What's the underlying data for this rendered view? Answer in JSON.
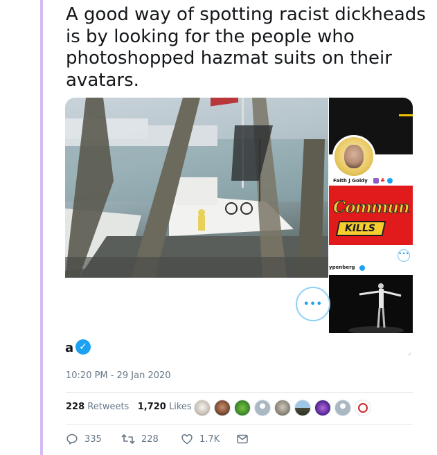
{
  "tweet": {
    "text": "A good way of spotting racist dickheads is by looking for the people who photoshopped hazmat suits on their avatars.",
    "timestamp": "10:20 PM - 29 Jan 2020",
    "retweets_count": "228",
    "retweets_label": "Retweets",
    "likes_count": "1,720",
    "likes_label": "Likes"
  },
  "media": {
    "avatar_name": "Faith J Goldy",
    "commu_text": "Commun",
    "kills_text": "KILLS",
    "penberg_name": "ypenberg",
    "partial_name": "a",
    "more_glyph": "•••",
    "small_more_glyph": "•••"
  },
  "actions": {
    "reply_count": "335",
    "retweet_count": "228",
    "like_count": "1.7K"
  },
  "likers": [
    "liker-1",
    "liker-2",
    "liker-3",
    "liker-4",
    "liker-5",
    "liker-6",
    "liker-7",
    "liker-8",
    "liker-9"
  ],
  "colors": {
    "thread_line": "#d3bdf0",
    "accent": "#1da1f2",
    "muted": "#657786"
  }
}
